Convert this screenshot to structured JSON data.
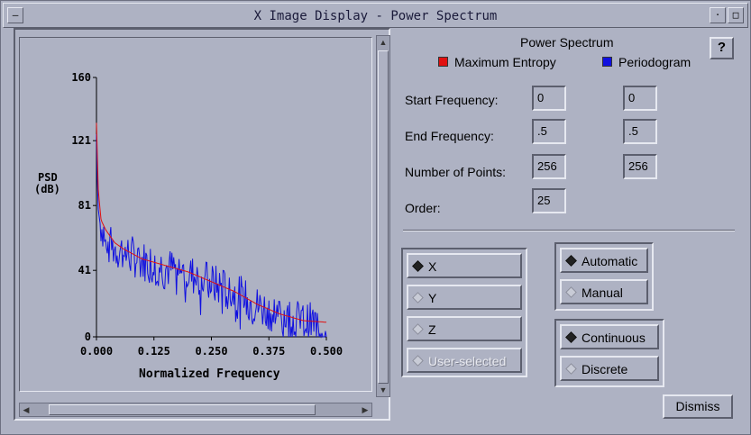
{
  "window": {
    "title": "X Image Display - Power Spectrum"
  },
  "plot": {
    "ylabel_line1": "PSD",
    "ylabel_line2": "(dB)",
    "xlabel": "Normalized Frequency",
    "y_ticks": [
      "160",
      "121",
      "81",
      "41",
      "0"
    ],
    "x_ticks": [
      "0.000",
      "0.125",
      "0.250",
      "0.375",
      "0.500"
    ]
  },
  "chart_data": {
    "type": "line",
    "xlabel": "Normalized Frequency",
    "ylabel": "PSD (dB)",
    "xlim": [
      0,
      0.5
    ],
    "ylim": [
      0,
      160
    ],
    "series": [
      {
        "name": "Maximum Entropy",
        "color": "#e01010",
        "x": [
          0,
          0.004,
          0.01,
          0.02,
          0.04,
          0.06,
          0.1,
          0.15,
          0.2,
          0.25,
          0.3,
          0.35,
          0.4,
          0.45,
          0.5
        ],
        "y": [
          132,
          90,
          72,
          66,
          58,
          54,
          48,
          44,
          40,
          34,
          28,
          20,
          14,
          10,
          9
        ]
      },
      {
        "name": "Periodogram",
        "color": "#1010e0",
        "x": [
          0,
          0.002,
          0.004,
          0.008,
          0.015,
          0.03,
          0.06,
          0.1,
          0.15,
          0.2,
          0.25,
          0.3,
          0.35,
          0.4,
          0.45,
          0.5
        ],
        "y": [
          125,
          95,
          78,
          70,
          66,
          56,
          52,
          47,
          43,
          39,
          33,
          27,
          19,
          14,
          9,
          8
        ]
      }
    ],
    "grid": false
  },
  "legend": {
    "heading": "Power Spectrum",
    "items": [
      {
        "label": "Maximum Entropy",
        "color": "#e01010"
      },
      {
        "label": "Periodogram",
        "color": "#1010e0"
      }
    ]
  },
  "params": {
    "start_label": "Start Frequency:",
    "end_label": "End Frequency:",
    "points_label": "Number of Points:",
    "order_label": "Order:",
    "me_start": "0",
    "pg_start": "0",
    "me_end": ".5",
    "pg_end": ".5",
    "me_points": "256",
    "pg_points": "256",
    "me_order": "25"
  },
  "axis_group": {
    "options": [
      {
        "label": "X",
        "selected": true,
        "enabled": true
      },
      {
        "label": "Y",
        "selected": false,
        "enabled": true
      },
      {
        "label": "Z",
        "selected": false,
        "enabled": true
      },
      {
        "label": "User-selected",
        "selected": false,
        "enabled": false
      }
    ]
  },
  "scale_group": {
    "automatic": "Automatic",
    "manual": "Manual",
    "selected": "Automatic"
  },
  "mode_group": {
    "continuous": "Continuous",
    "discrete": "Discrete",
    "selected": "Continuous"
  },
  "buttons": {
    "help": "?",
    "dismiss": "Dismiss"
  }
}
